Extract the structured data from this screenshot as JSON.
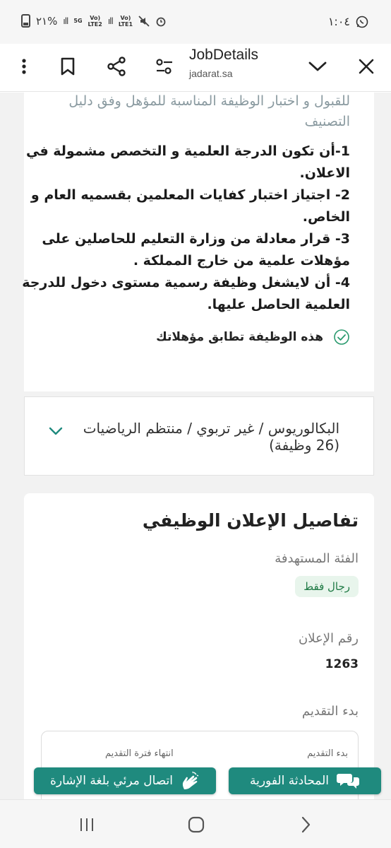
{
  "status_bar": {
    "battery": "٢١%",
    "network1": "Vo)\nLTE2",
    "network2": "Vo)\nLTE1",
    "network_5g": "5G",
    "time": "١:٠٤"
  },
  "app_bar": {
    "title": "JobDetails",
    "url": "jadarat.sa",
    "icons": [
      "more-icon",
      "bookmark-icon",
      "share-icon",
      "settings-icon",
      "chevron-down-icon",
      "close-icon"
    ]
  },
  "requirements": {
    "faded_text": "للقبول و اختبار الوظيفة المناسبة للمؤهل وفق دليل التصنيف",
    "items": [
      "1-أن تكون الدرجة العلمية و التخصص مشمولة في الاعلان.",
      "2- اجتياز اختبار كفايات المعلمين بقسميه العام و الخاص.",
      "3- قرار معادلة من وزارة التعليم للحاصلين على مؤهلات علمية من خارج المملكة .",
      "4- أن لايشغل وظيفة رسمية مستوى دخول للدرجة العلمية الحاصل عليها."
    ],
    "match_text": "هذه الوظيفة تطابق مؤهلاتك"
  },
  "qualification": {
    "title": "البكالوريوس / غير تربوي / منتظم الرياضيات (26 وظيفة)"
  },
  "details": {
    "section_title": "تفاصيل الإعلان الوظيفي",
    "target_label": "الفئة المستهدفة",
    "target_value": "رجال فقط",
    "ad_number_label": "رقم الإعلان",
    "ad_number": "1263",
    "apply_start_label": "بدء التقديم",
    "apply_start_col": "بدء التقديم",
    "apply_end_col": "انتهاء فترة التقديم"
  },
  "floating_buttons": {
    "chat": "المحادثة الفورية",
    "sign_language": "اتصال مرئي بلغة الإشارة"
  },
  "colors": {
    "accent": "#1f8a7e",
    "badge_bg": "#e8f5ec",
    "badge_text": "#1f7a45",
    "faded_text": "#8a9aa0"
  }
}
